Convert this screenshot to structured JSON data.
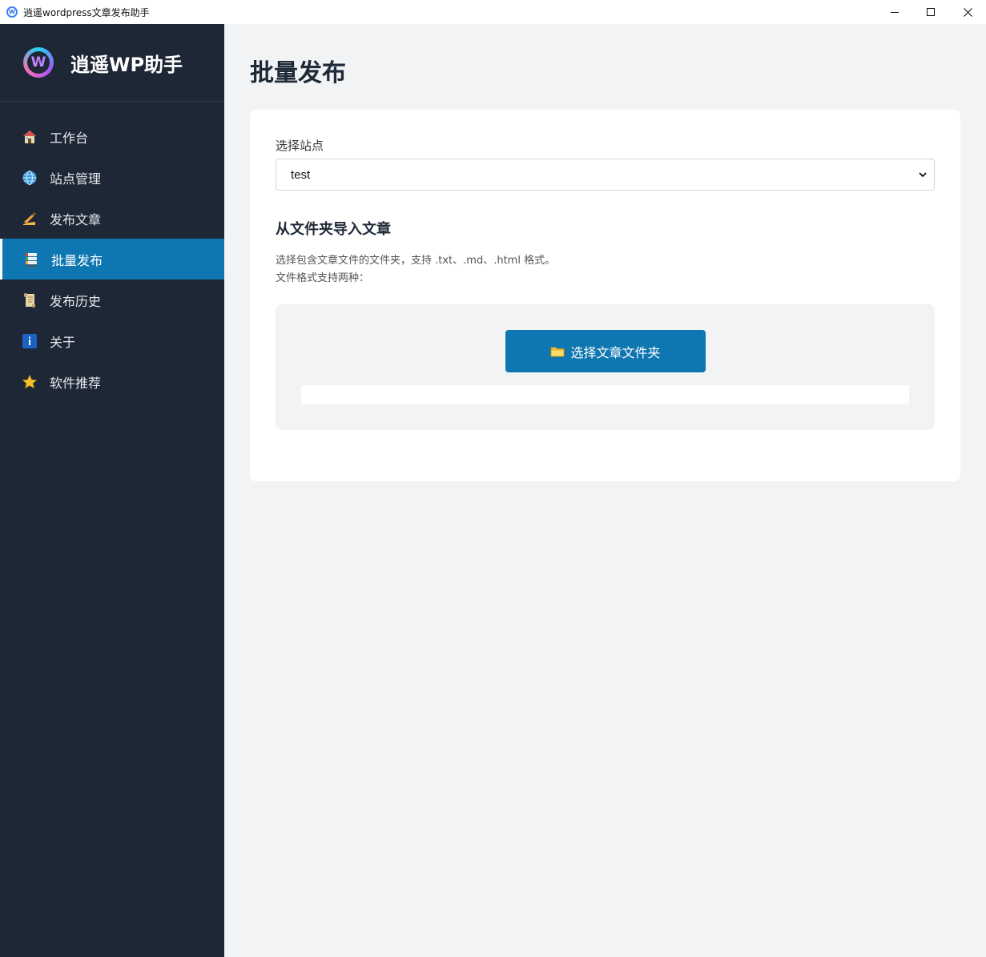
{
  "window": {
    "title": "逍遥wordpress文章发布助手",
    "icon": "app-logo-icon"
  },
  "brand": {
    "name": "逍遥WP助手",
    "logo_letter": "W"
  },
  "sidebar": {
    "items": [
      {
        "label": "工作台",
        "icon": "house-icon",
        "active": false
      },
      {
        "label": "站点管理",
        "icon": "globe-icon",
        "active": false
      },
      {
        "label": "发布文章",
        "icon": "writing-hand-icon",
        "active": false
      },
      {
        "label": "批量发布",
        "icon": "books-icon",
        "active": true
      },
      {
        "label": "发布历史",
        "icon": "scroll-icon",
        "active": false
      },
      {
        "label": "关于",
        "icon": "info-icon",
        "active": false
      },
      {
        "label": "软件推荐",
        "icon": "star-icon",
        "active": false
      }
    ]
  },
  "main": {
    "page_title": "批量发布",
    "site_label": "选择站点",
    "site_selected": "test",
    "section_title": "从文件夹导入文章",
    "description_line1": "选择包含文章文件的文件夹，支持 .txt、.md、.html 格式。",
    "description_line2": "文件格式支持两种：",
    "pick_folder_button": "选择文章文件夹"
  },
  "colors": {
    "sidebar_bg": "#1e2736",
    "accent": "#0e76b0",
    "page_bg": "#f2f3f5"
  }
}
